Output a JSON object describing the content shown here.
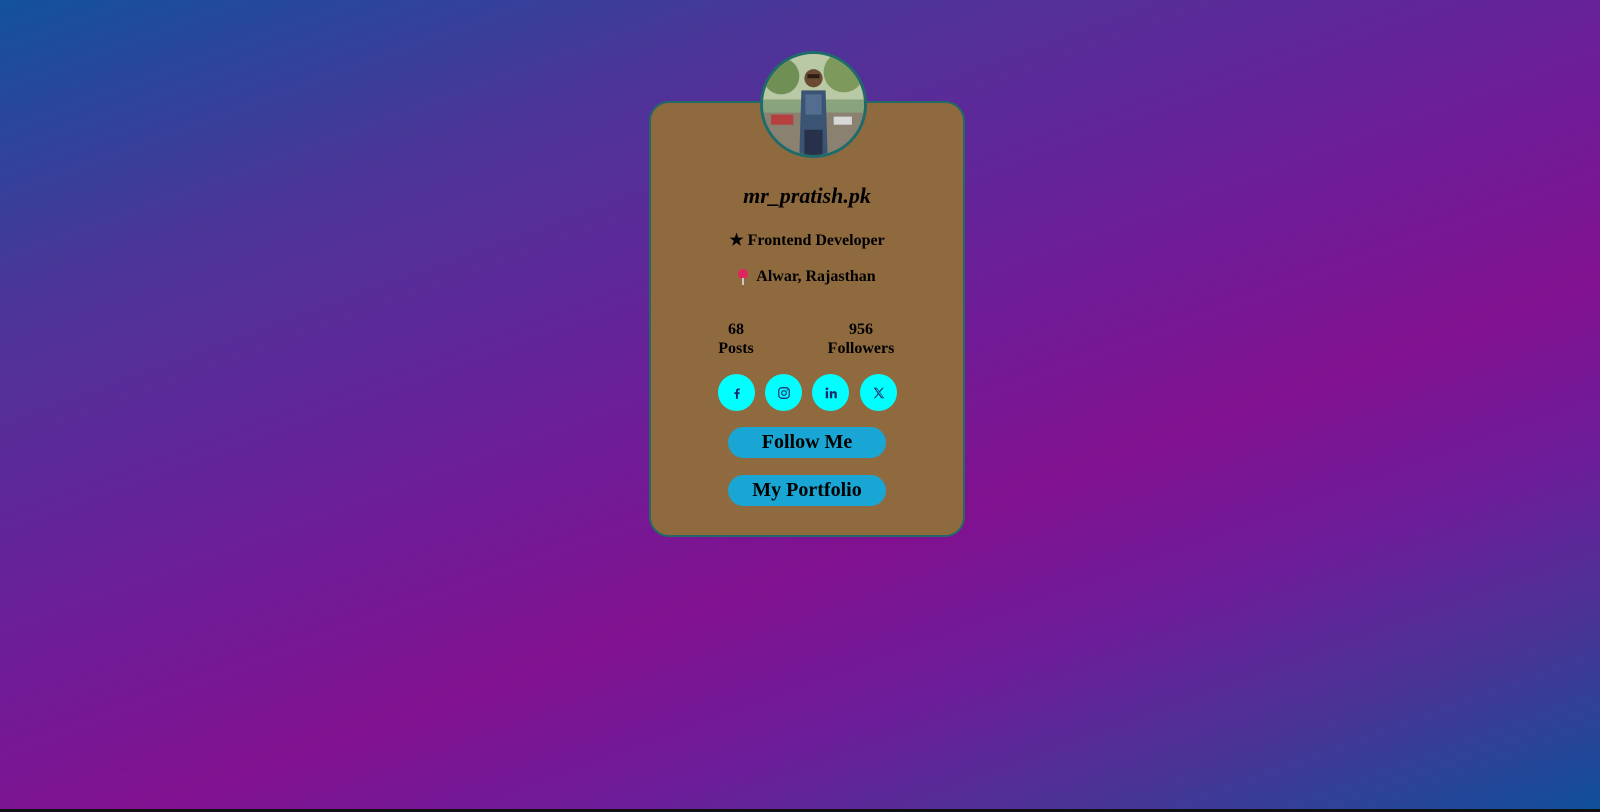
{
  "profile": {
    "username": "mr_pratish.pk",
    "role_star": "★",
    "role": "Frontend Developer",
    "location": "Alwar, Rajasthan",
    "avatar_icon": "profile-photo"
  },
  "stats": [
    {
      "value": "68",
      "label": "Posts"
    },
    {
      "value": "956",
      "label": "Followers"
    }
  ],
  "social": [
    {
      "icon": "facebook-icon"
    },
    {
      "icon": "instagram-icon"
    },
    {
      "icon": "linkedin-icon"
    },
    {
      "icon": "x-twitter-icon"
    }
  ],
  "buttons": {
    "follow": "Follow Me",
    "portfolio": "My Portfolio"
  },
  "colors": {
    "card_bg": "#8f6a3f",
    "card_border": "#236a66",
    "social_bg": "#00ffff",
    "button_bg": "#19a6d4"
  }
}
